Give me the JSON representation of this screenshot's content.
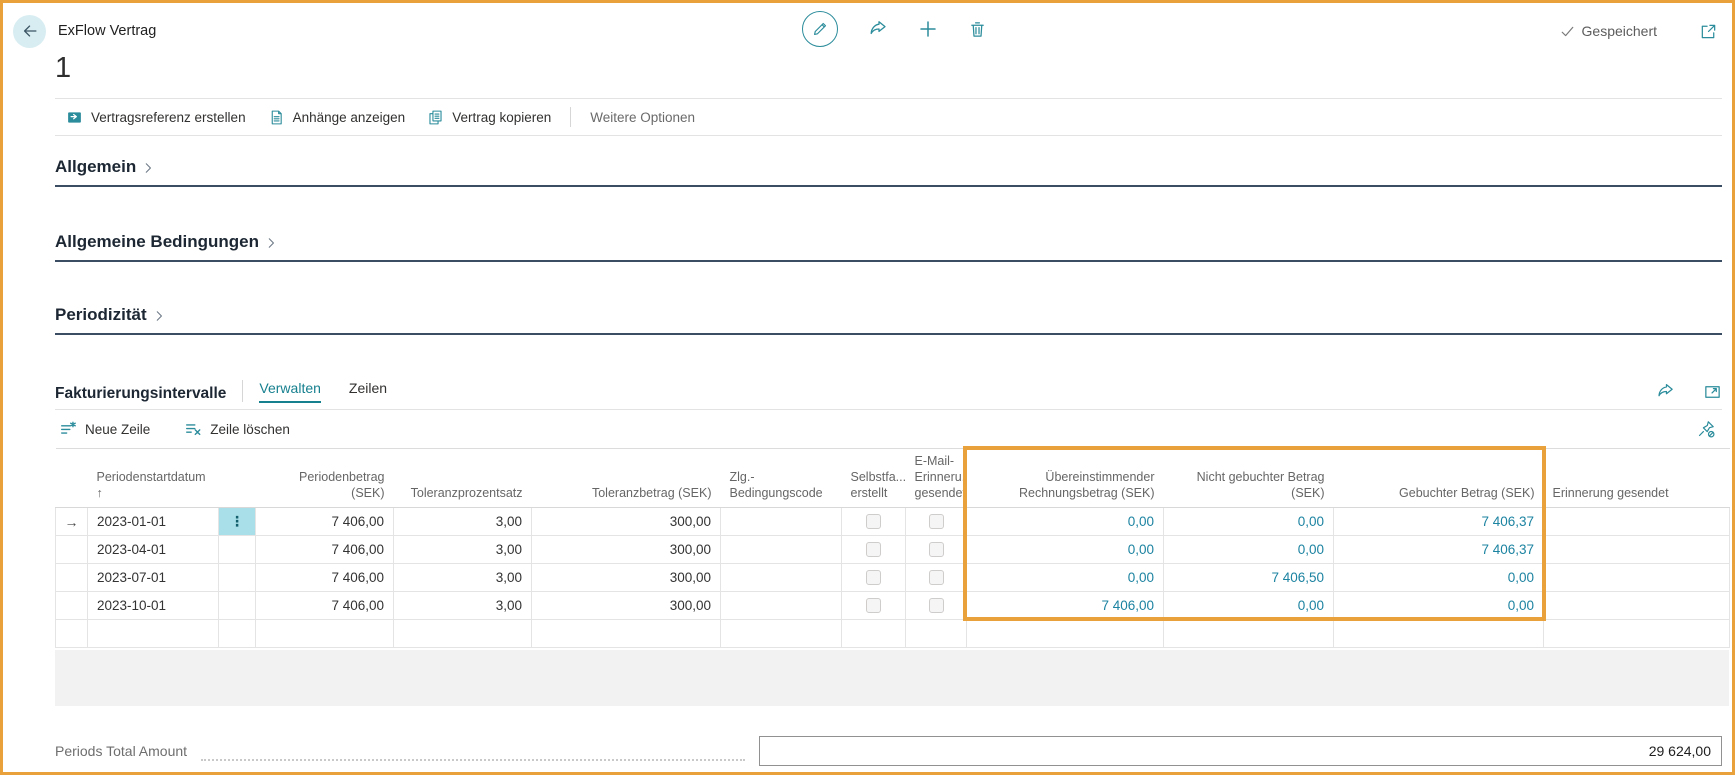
{
  "colors": {
    "accent_teal": "#2b8c9b",
    "link_teal": "#1c83a1",
    "highlight_orange": "#E9A23B",
    "section_underline": "#3b4d63",
    "selected_cell_bg": "#a9dfe8"
  },
  "header": {
    "app_title": "ExFlow Vertrag",
    "page_title": "1",
    "saved_status": "Gespeichert"
  },
  "command_bar": {
    "items": [
      "Vertragsreferenz erstellen",
      "Anhänge anzeigen",
      "Vertrag kopieren"
    ],
    "more_options": "Weitere Optionen"
  },
  "sections": [
    {
      "title": "Allgemein"
    },
    {
      "title": "Allgemeine Bedingungen"
    },
    {
      "title": "Periodizität"
    }
  ],
  "subpage": {
    "title": "Fakturierungsintervalle",
    "tabs": [
      {
        "label": "Verwalten",
        "active": true
      },
      {
        "label": "Zeilen",
        "active": false
      }
    ],
    "actions": [
      {
        "label": "Neue Zeile"
      },
      {
        "label": "Zeile löschen"
      }
    ]
  },
  "grid": {
    "columns": {
      "date": "Periodenstartdatum\n↑",
      "period_amount": "Periodenbetrag (SEK)",
      "tolerance_pct": "Toleranzprozentsatz",
      "tolerance_amount": "Toleranzbetrag (SEK)",
      "payment_terms": "Zlg.-Bedingungscode",
      "self_invoice": "Selbstfa...\nerstellt",
      "email_reminder": "E-Mail-\nErinneru...\ngesendet",
      "matched": "Übereinstimmender\nRechnungsbetrag (SEK)",
      "unposted": "Nicht gebuchter Betrag\n(SEK)",
      "posted": "Gebuchter Betrag (SEK)",
      "reminder_sent": "Erinnerung gesendet"
    },
    "rows": [
      {
        "marker": "→",
        "menu": "⋮",
        "date": "2023-01-01",
        "period_amount": "7 406,00",
        "tolerance_pct": "3,00",
        "tolerance_amount": "300,00",
        "payment_terms": "",
        "matched": "0,00",
        "unposted": "0,00",
        "posted": "7 406,37",
        "reminder_sent": ""
      },
      {
        "marker": "",
        "menu": "",
        "date": "2023-04-01",
        "period_amount": "7 406,00",
        "tolerance_pct": "3,00",
        "tolerance_amount": "300,00",
        "payment_terms": "",
        "matched": "0,00",
        "unposted": "0,00",
        "posted": "7 406,37",
        "reminder_sent": ""
      },
      {
        "marker": "",
        "menu": "",
        "date": "2023-07-01",
        "period_amount": "7 406,00",
        "tolerance_pct": "3,00",
        "tolerance_amount": "300,00",
        "payment_terms": "",
        "matched": "0,00",
        "unposted": "7 406,50",
        "posted": "0,00",
        "reminder_sent": ""
      },
      {
        "marker": "",
        "menu": "",
        "date": "2023-10-01",
        "period_amount": "7 406,00",
        "tolerance_pct": "3,00",
        "tolerance_amount": "300,00",
        "payment_terms": "",
        "matched": "7 406,00",
        "unposted": "0,00",
        "posted": "0,00",
        "reminder_sent": ""
      }
    ]
  },
  "footer": {
    "label": "Periods Total Amount",
    "value": "29 624,00"
  }
}
